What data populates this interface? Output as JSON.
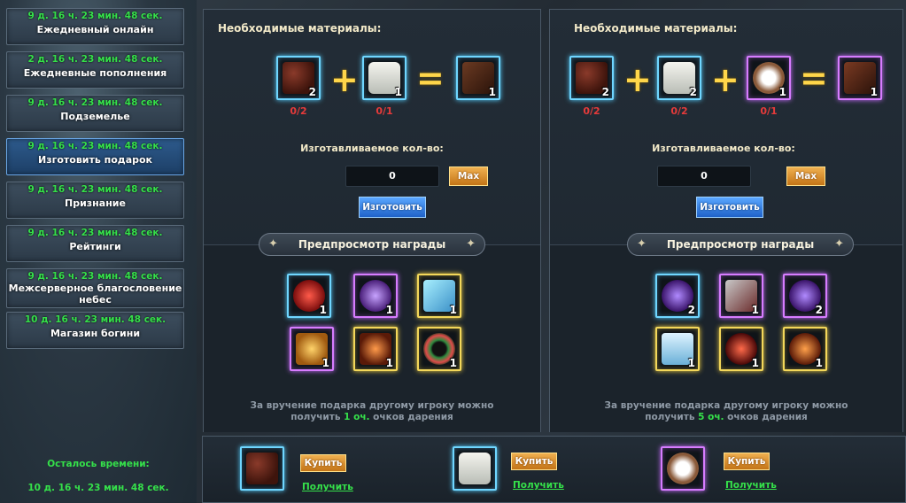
{
  "sidebar": {
    "items": [
      {
        "timer": "9 д. 16 ч. 23 мин. 48 сек.",
        "label": "Ежедневный онлайн"
      },
      {
        "timer": "2 д. 16 ч. 23 мин. 48 сек.",
        "label": "Ежедневные пополнения"
      },
      {
        "timer": "9 д. 16 ч. 23 мин. 48 сек.",
        "label": "Подземелье"
      },
      {
        "timer": "9 д. 16 ч. 23 мин. 48 сек.",
        "label": "Изготовить подарок"
      },
      {
        "timer": "9 д. 16 ч. 23 мин. 48 сек.",
        "label": "Признание"
      },
      {
        "timer": "9 д. 16 ч. 23 мин. 48 сек.",
        "label": "Рейтинги"
      },
      {
        "timer": "9 д. 16 ч. 23 мин. 48 сек.",
        "label": "Межсерверное благословение небес"
      },
      {
        "timer": "10 д. 16 ч. 23 мин. 48 сек.",
        "label": "Магазин богини"
      }
    ],
    "active_index": 3,
    "remaining_title": "Осталось времени:",
    "remaining_value": "10 д. 16 ч. 23 мин. 48 сек."
  },
  "panels": [
    {
      "materials_title": "Необходимые материалы:",
      "ingredients": [
        {
          "icon": "cocoa-beans-icon",
          "count": "2",
          "need": "0/2"
        },
        {
          "icon": "milk-mug-icon",
          "count": "1",
          "need": "0/1"
        }
      ],
      "result": {
        "icon": "chocolate-bar-icon",
        "count": "1"
      },
      "qty_label": "Изготавливаемое кол-во:",
      "qty_value": "0",
      "max_label": "Max",
      "make_label": "Изготовить",
      "preview_title": "Предпросмотр награды",
      "rewards": [
        {
          "icon": "red-crystal-shard-icon",
          "count": "1",
          "frame": "blue"
        },
        {
          "icon": "couple-figurine-icon",
          "count": "1",
          "frame": "purple"
        },
        {
          "icon": "winged-pet-icon",
          "count": "1",
          "frame": "gold"
        },
        {
          "icon": "gold-gem-icon",
          "count": "1",
          "frame": "purple"
        },
        {
          "icon": "heart-emblem-icon",
          "count": "1",
          "frame": "gold"
        },
        {
          "icon": "flower-wreath-icon",
          "count": "1",
          "frame": "gold"
        }
      ],
      "note_line1": "За вручение подарка другому игроку можно",
      "note_prefix": "получить",
      "note_points": "1 оч.",
      "note_suffix": "очков дарения"
    },
    {
      "materials_title": "Необходимые материалы:",
      "ingredients": [
        {
          "icon": "cocoa-beans-icon",
          "count": "2",
          "need": "0/2"
        },
        {
          "icon": "milk-mug-icon",
          "count": "2",
          "need": "0/2"
        },
        {
          "icon": "flour-bowl-icon",
          "count": "1",
          "need": "0/1"
        }
      ],
      "result": {
        "icon": "chocolate-pieces-icon",
        "count": "1"
      },
      "qty_label": "Изготавливаемое кол-во:",
      "qty_value": "0",
      "max_label": "Max",
      "make_label": "Изготовить",
      "preview_title": "Предпросмотр награды",
      "rewards": [
        {
          "icon": "purple-orb-scroll-icon",
          "count": "2",
          "frame": "blue"
        },
        {
          "icon": "armored-mount-icon",
          "count": "1",
          "frame": "purple"
        },
        {
          "icon": "purple-orb-bell-icon",
          "count": "2",
          "frame": "purple"
        },
        {
          "icon": "ice-landscape-icon",
          "count": "1",
          "frame": "gold"
        },
        {
          "icon": "red-sword-icon",
          "count": "1",
          "frame": "gold"
        },
        {
          "icon": "exp-orb-icon",
          "count": "1",
          "frame": "gold"
        }
      ],
      "note_line1": "За вручение подарка другому игроку можно",
      "note_prefix": "получить",
      "note_points": "5 оч.",
      "note_suffix": "очков дарения"
    }
  ],
  "shop": [
    {
      "icon": "cocoa-beans-icon",
      "buy_label": "Купить",
      "get_label": "Получить"
    },
    {
      "icon": "milk-mug-icon",
      "buy_label": "Купить",
      "get_label": "Получить"
    },
    {
      "icon": "flour-bowl-icon",
      "buy_label": "Купить",
      "get_label": "Получить"
    }
  ],
  "colors": {
    "timer_green": "#35e04a",
    "need_red": "#e53a3a",
    "operator_gold": "#ffd64a",
    "frame_blue": "#6fd6ff",
    "frame_purple": "#d77cff",
    "frame_gold": "#f3d75a"
  }
}
